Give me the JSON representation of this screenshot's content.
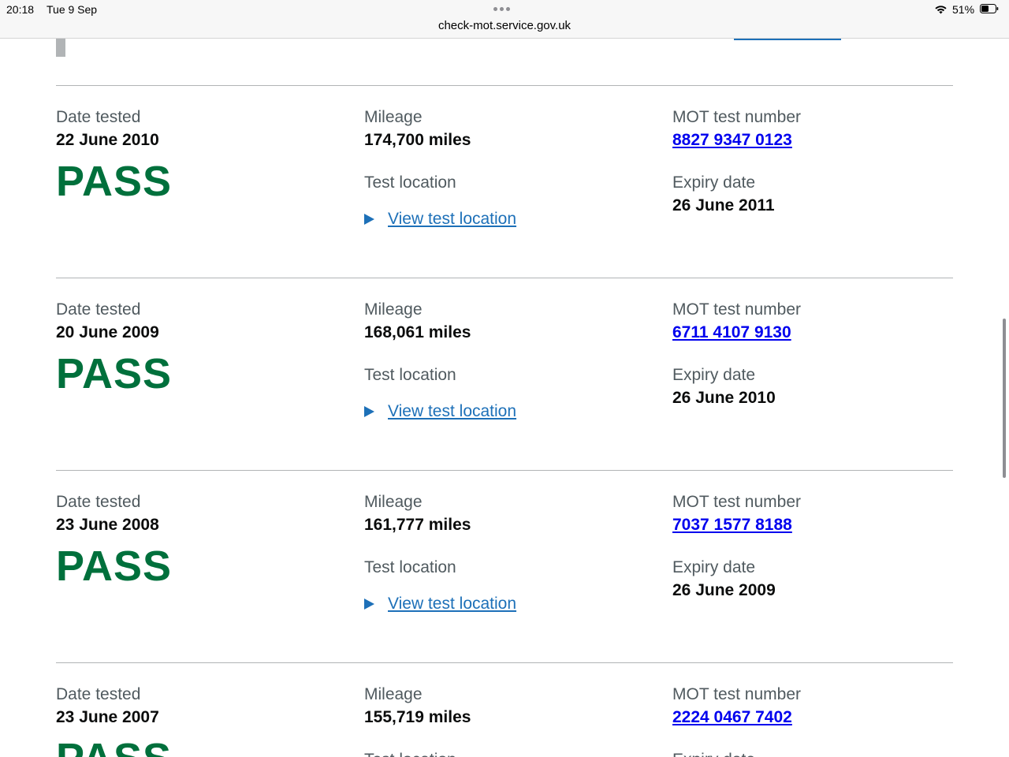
{
  "status_bar": {
    "time": "20:18",
    "date": "Tue 9 Sep",
    "url": "check-mot.service.gov.uk",
    "battery": "51%"
  },
  "labels": {
    "date_tested": "Date tested",
    "mileage": "Mileage",
    "test_location": "Test location",
    "mot_test_number": "MOT test number",
    "expiry_date": "Expiry date",
    "view_test_location": "View test location"
  },
  "records": [
    {
      "date_tested": "22 June 2010",
      "result": "PASS",
      "mileage": "174,700 miles",
      "test_number": "8827 9347 0123",
      "expiry_date": "26 June 2011"
    },
    {
      "date_tested": "20 June 2009",
      "result": "PASS",
      "mileage": "168,061 miles",
      "test_number": "6711 4107 9130",
      "expiry_date": "26 June 2010"
    },
    {
      "date_tested": "23 June 2008",
      "result": "PASS",
      "mileage": "161,777 miles",
      "test_number": "7037 1577 8188",
      "expiry_date": "26 June 2009"
    },
    {
      "date_tested": "23 June 2007",
      "result": "PASS",
      "mileage": "155,719 miles",
      "test_number": "2224 0467 7402",
      "expiry_date": "",
      "label_test_location": "Test location",
      "label_expiry_date": "Expiry date"
    }
  ],
  "colors": {
    "pass_green": "#00703c",
    "link_blue": "#1d70b8",
    "test_number_blue": "#0000ee",
    "label_grey": "#505a5f",
    "divider_grey": "#b1b4b6"
  }
}
